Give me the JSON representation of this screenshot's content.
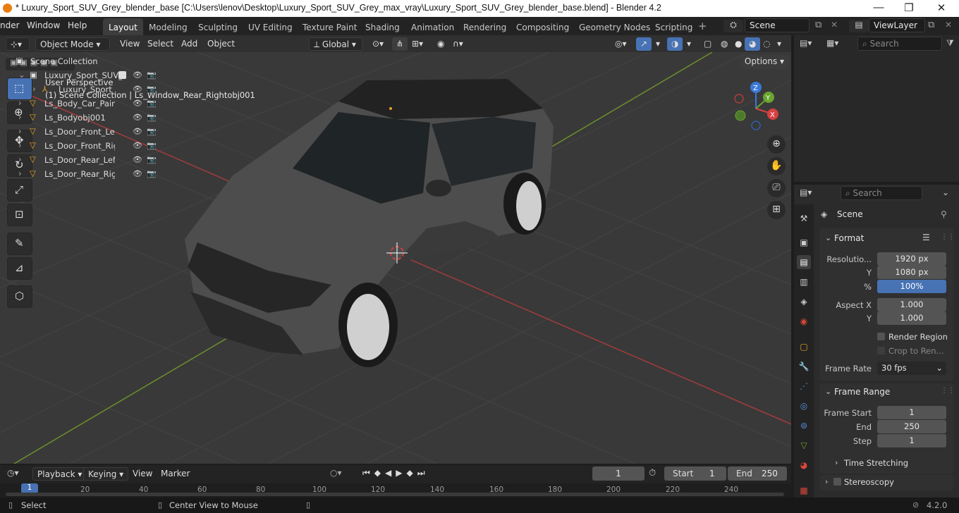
{
  "window": {
    "title": "* Luxury_Sport_SUV_Grey_blender_base [C:\\Users\\lenov\\Desktop\\Luxury_Sport_SUV_Grey_max_vray\\Luxury_Sport_SUV_Grey_blender_base.blend] - Blender 4.2",
    "minimize": "—",
    "restore": "❐",
    "close": "✕"
  },
  "menubar": {
    "items": [
      "nder",
      "Window",
      "Help"
    ]
  },
  "workspaces": [
    "Layout",
    "Modeling",
    "Sculpting",
    "UV Editing",
    "Texture Paint",
    "Shading",
    "Animation",
    "Rendering",
    "Compositing",
    "Geometry Nodes",
    "Scripting"
  ],
  "scene": {
    "name": "Scene",
    "viewlayer": "ViewLayer"
  },
  "viewport_header": {
    "mode": "Object Mode",
    "menus": [
      "View",
      "Select",
      "Add",
      "Object"
    ],
    "orientation": "Global",
    "options": "Options"
  },
  "viewport": {
    "perspective": "User Perspective",
    "collection_info": "(1) Scene Collection | Ls_Window_Rear_Rightobj001",
    "gizmo": {
      "x": "X",
      "y": "Y",
      "z": "Z"
    }
  },
  "outliner": {
    "search_placeholder": "Search",
    "root": "Scene Collection",
    "rows": [
      "Luxury_Sport_SUV_",
      "Luxury_Sport_S",
      "Ls_Body_Car_Paint",
      "Ls_Bodyobj001",
      "Ls_Door_Front_Left",
      "Ls_Door_Front_Righ",
      "Ls_Door_Rear_Left_",
      "Ls_Door_Rear_Righ"
    ]
  },
  "properties": {
    "search_placeholder": "Search",
    "context": "Scene",
    "format": {
      "title": "Format",
      "res_label": "Resolutio...",
      "res_x": "1920 px",
      "y_label": "Y",
      "res_y": "1080 px",
      "pct_label": "%",
      "pct": "100%",
      "aspect_label": "Aspect X",
      "aspect_x": "1.000",
      "aspect_y_label": "Y",
      "aspect_y": "1.000",
      "render_region": "Render Region",
      "crop": "Crop to Ren...",
      "frame_rate_label": "Frame Rate",
      "frame_rate": "30 fps"
    },
    "frame_range": {
      "title": "Frame Range",
      "start_label": "Frame Start",
      "start": "1",
      "end_label": "End",
      "end": "250",
      "step_label": "Step",
      "step": "1"
    },
    "time_stretching": "Time Stretching",
    "stereoscopy": "Stereoscopy"
  },
  "timeline": {
    "menus": [
      "Playback",
      "Keying",
      "View",
      "Marker"
    ],
    "current_frame": "1",
    "start_label": "Start",
    "start": "1",
    "end_label": "End",
    "end": "250",
    "ticks": [
      "1",
      "20",
      "40",
      "60",
      "80",
      "100",
      "120",
      "140",
      "160",
      "180",
      "200",
      "220",
      "240"
    ]
  },
  "statusbar": {
    "select": "Select",
    "center": "Center View to Mouse",
    "version": "4.2.0"
  }
}
